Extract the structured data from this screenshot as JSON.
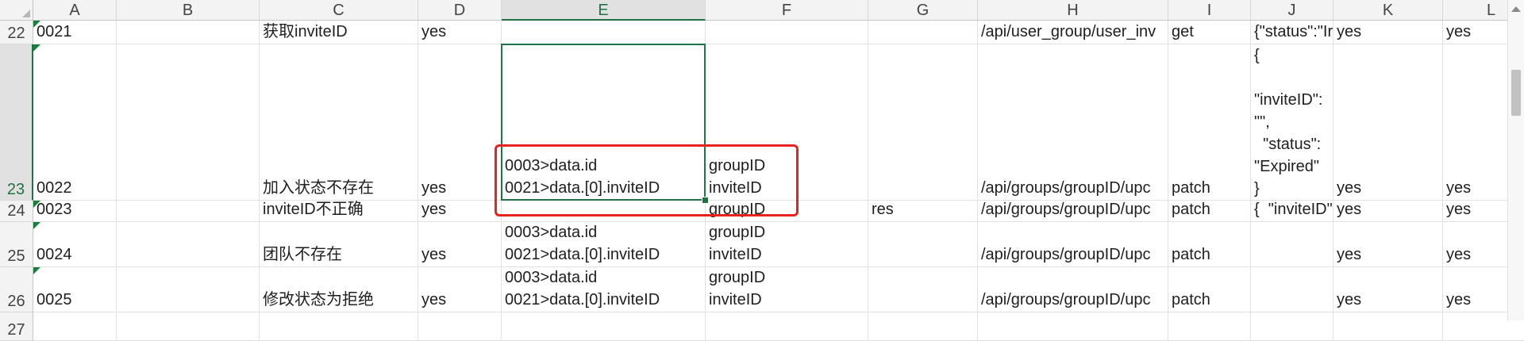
{
  "sheet": {
    "selected_column": "E",
    "selected_row": "23",
    "columns": [
      "A",
      "B",
      "C",
      "D",
      "E",
      "F",
      "G",
      "H",
      "I",
      "J",
      "K",
      "L"
    ],
    "rows": [
      {
        "number": "22",
        "cells": {
          "A": "0021",
          "C": "获取inviteID",
          "D": "yes",
          "H": "/api/user_group/user_inv",
          "I": "get",
          "J": "{\"status\":\"Ir",
          "K": "yes",
          "L": "yes"
        }
      },
      {
        "number": "23",
        "cells": {
          "A": "0022",
          "C": "加入状态不存在",
          "D": "yes",
          "E": [
            "0003>data.id",
            "0021>data.[0].inviteID"
          ],
          "F": [
            "groupID",
            "inviteID"
          ],
          "H": "/api/groups/groupID/upc",
          "I": "patch",
          "J": [
            "{",
            "",
            "\"inviteID\":",
            "\"\",",
            "  \"status\":",
            "\"Expired\"",
            "}"
          ],
          "K": "yes",
          "L": "yes"
        }
      },
      {
        "number": "24",
        "cells": {
          "A": "0023",
          "C": "inviteID不正确",
          "D": "yes",
          "F": "groupID",
          "G": "res",
          "H": "/api/groups/groupID/upc",
          "I": "patch",
          "J": "{  \"inviteID\"",
          "K": "yes",
          "L": "yes"
        }
      },
      {
        "number": "25",
        "cells": {
          "A": "0024",
          "C": "团队不存在",
          "D": "yes",
          "E": [
            "0003>data.id",
            "0021>data.[0].inviteID"
          ],
          "F": [
            "groupID",
            "inviteID"
          ],
          "H": "/api/groups/groupID/upc",
          "I": "patch",
          "K": "yes",
          "L": "yes"
        }
      },
      {
        "number": "26",
        "cells": {
          "A": "0025",
          "C": "修改状态为拒绝",
          "D": "yes",
          "E": [
            "0003>data.id",
            "0021>data.[0].inviteID"
          ],
          "F": [
            "groupID",
            "inviteID"
          ],
          "H": "/api/groups/groupID/upc",
          "I": "patch",
          "K": "yes",
          "L": "yes"
        }
      },
      {
        "number": "27",
        "cells": {}
      }
    ]
  },
  "colors": {
    "accent_green": "#217346",
    "annotation_red": "#e8231b"
  },
  "icons": [
    "comment-indicator-icon",
    "scroll-up-arrow-icon"
  ]
}
